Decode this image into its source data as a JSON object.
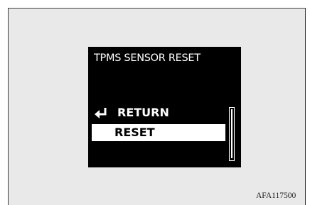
{
  "screen": {
    "title": "TPMS SENSOR RESET",
    "menu": {
      "items": [
        {
          "label": "RETURN",
          "icon": "return-arrow-icon",
          "selected": false
        },
        {
          "label": "RESET",
          "selected": true
        }
      ]
    },
    "colors": {
      "background": "#000000",
      "text": "#ffffff",
      "highlight": "#ffffff",
      "highlight_text": "#000000"
    }
  },
  "figure": {
    "code": "AFA117500"
  }
}
